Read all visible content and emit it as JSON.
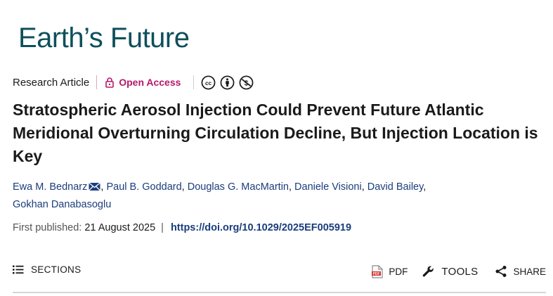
{
  "journal": {
    "name": "Earth’s Future"
  },
  "meta": {
    "article_type": "Research Article",
    "access_label": "Open Access",
    "license_icons": [
      "creative-commons-icon",
      "attribution-icon",
      "non-commercial-icon"
    ],
    "access_color": "#b5186b"
  },
  "title": "Stratospheric Aerosol Injection Could Prevent Future Atlantic Meridional Overturning Circulation Decline, But Injection Location is Key",
  "authors": [
    "Ewa M. Bednarz",
    "Paul B. Goddard",
    "Douglas G. MacMartin",
    "Daniele Visioni",
    "David Bailey",
    "Gokhan Danabasoglu"
  ],
  "publication": {
    "label": "First published:",
    "date": "21 August 2025",
    "separator": "|",
    "doi": "https://doi.org/10.1029/2025EF005919"
  },
  "toolbar": {
    "sections_label": "SECTIONS",
    "pdf_label": "PDF",
    "tools_label": "TOOLS",
    "share_label": "SHARE"
  },
  "colors": {
    "brand": "#0e4f5c",
    "link": "#1a3d7c"
  }
}
